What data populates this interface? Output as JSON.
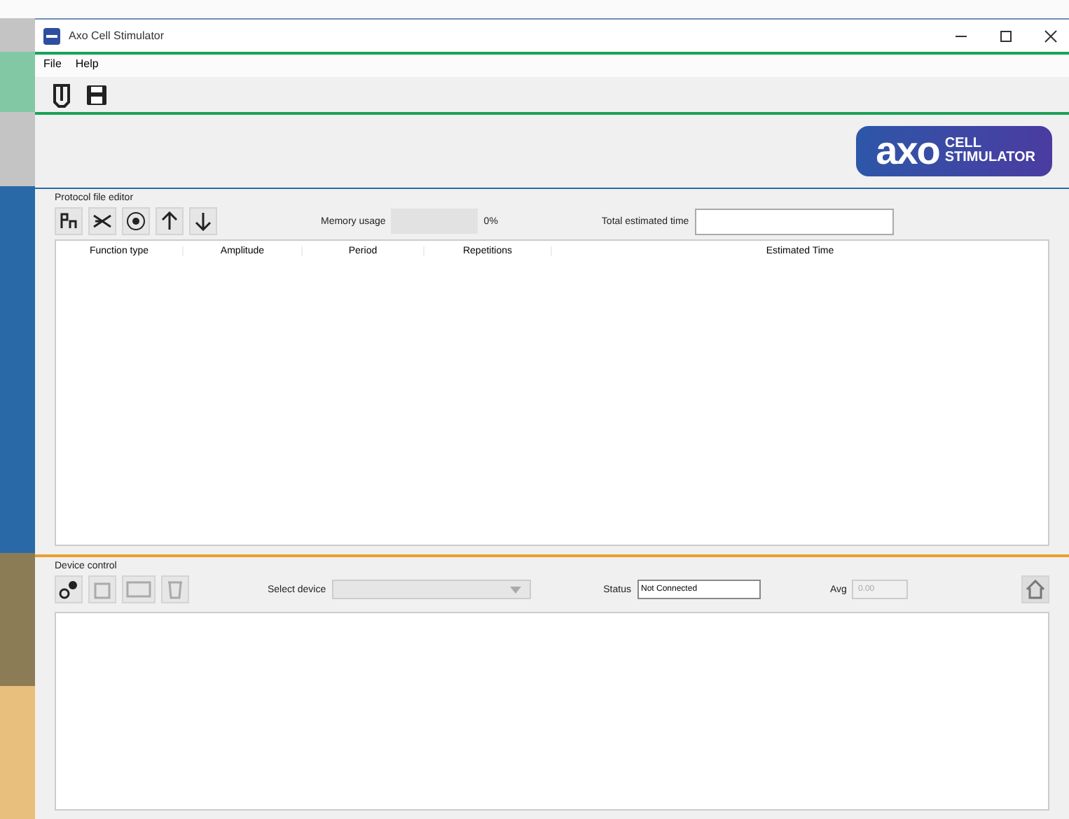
{
  "window": {
    "title": "Axo Cell Stimulator"
  },
  "markers": [
    {
      "color": "#c4c4c4"
    },
    {
      "color": "#82c8a4"
    },
    {
      "color": "#c4c4c4"
    },
    {
      "color": "#2a69a8"
    },
    {
      "color": "#8b7c55"
    },
    {
      "color": "#e8bf7c"
    }
  ],
  "menu": [
    "File",
    "Help"
  ],
  "logo": {
    "mark": "axo",
    "line1": "CELL",
    "line2": "STIMULATOR"
  },
  "protocol_editor": {
    "title": "Protocol file editor",
    "memory_label": "Memory usage",
    "memory_unit": "0%",
    "total_label": "Total estimated time",
    "columns": [
      "Function type",
      "Amplitude",
      "Period",
      "Repetitions",
      "Estimated Time"
    ]
  },
  "device_control": {
    "title": "Device control",
    "select_label": "Select device",
    "status_label": "Status",
    "status_value": "Not Connected",
    "avg_label": "Avg",
    "avg_value": "0.00"
  }
}
